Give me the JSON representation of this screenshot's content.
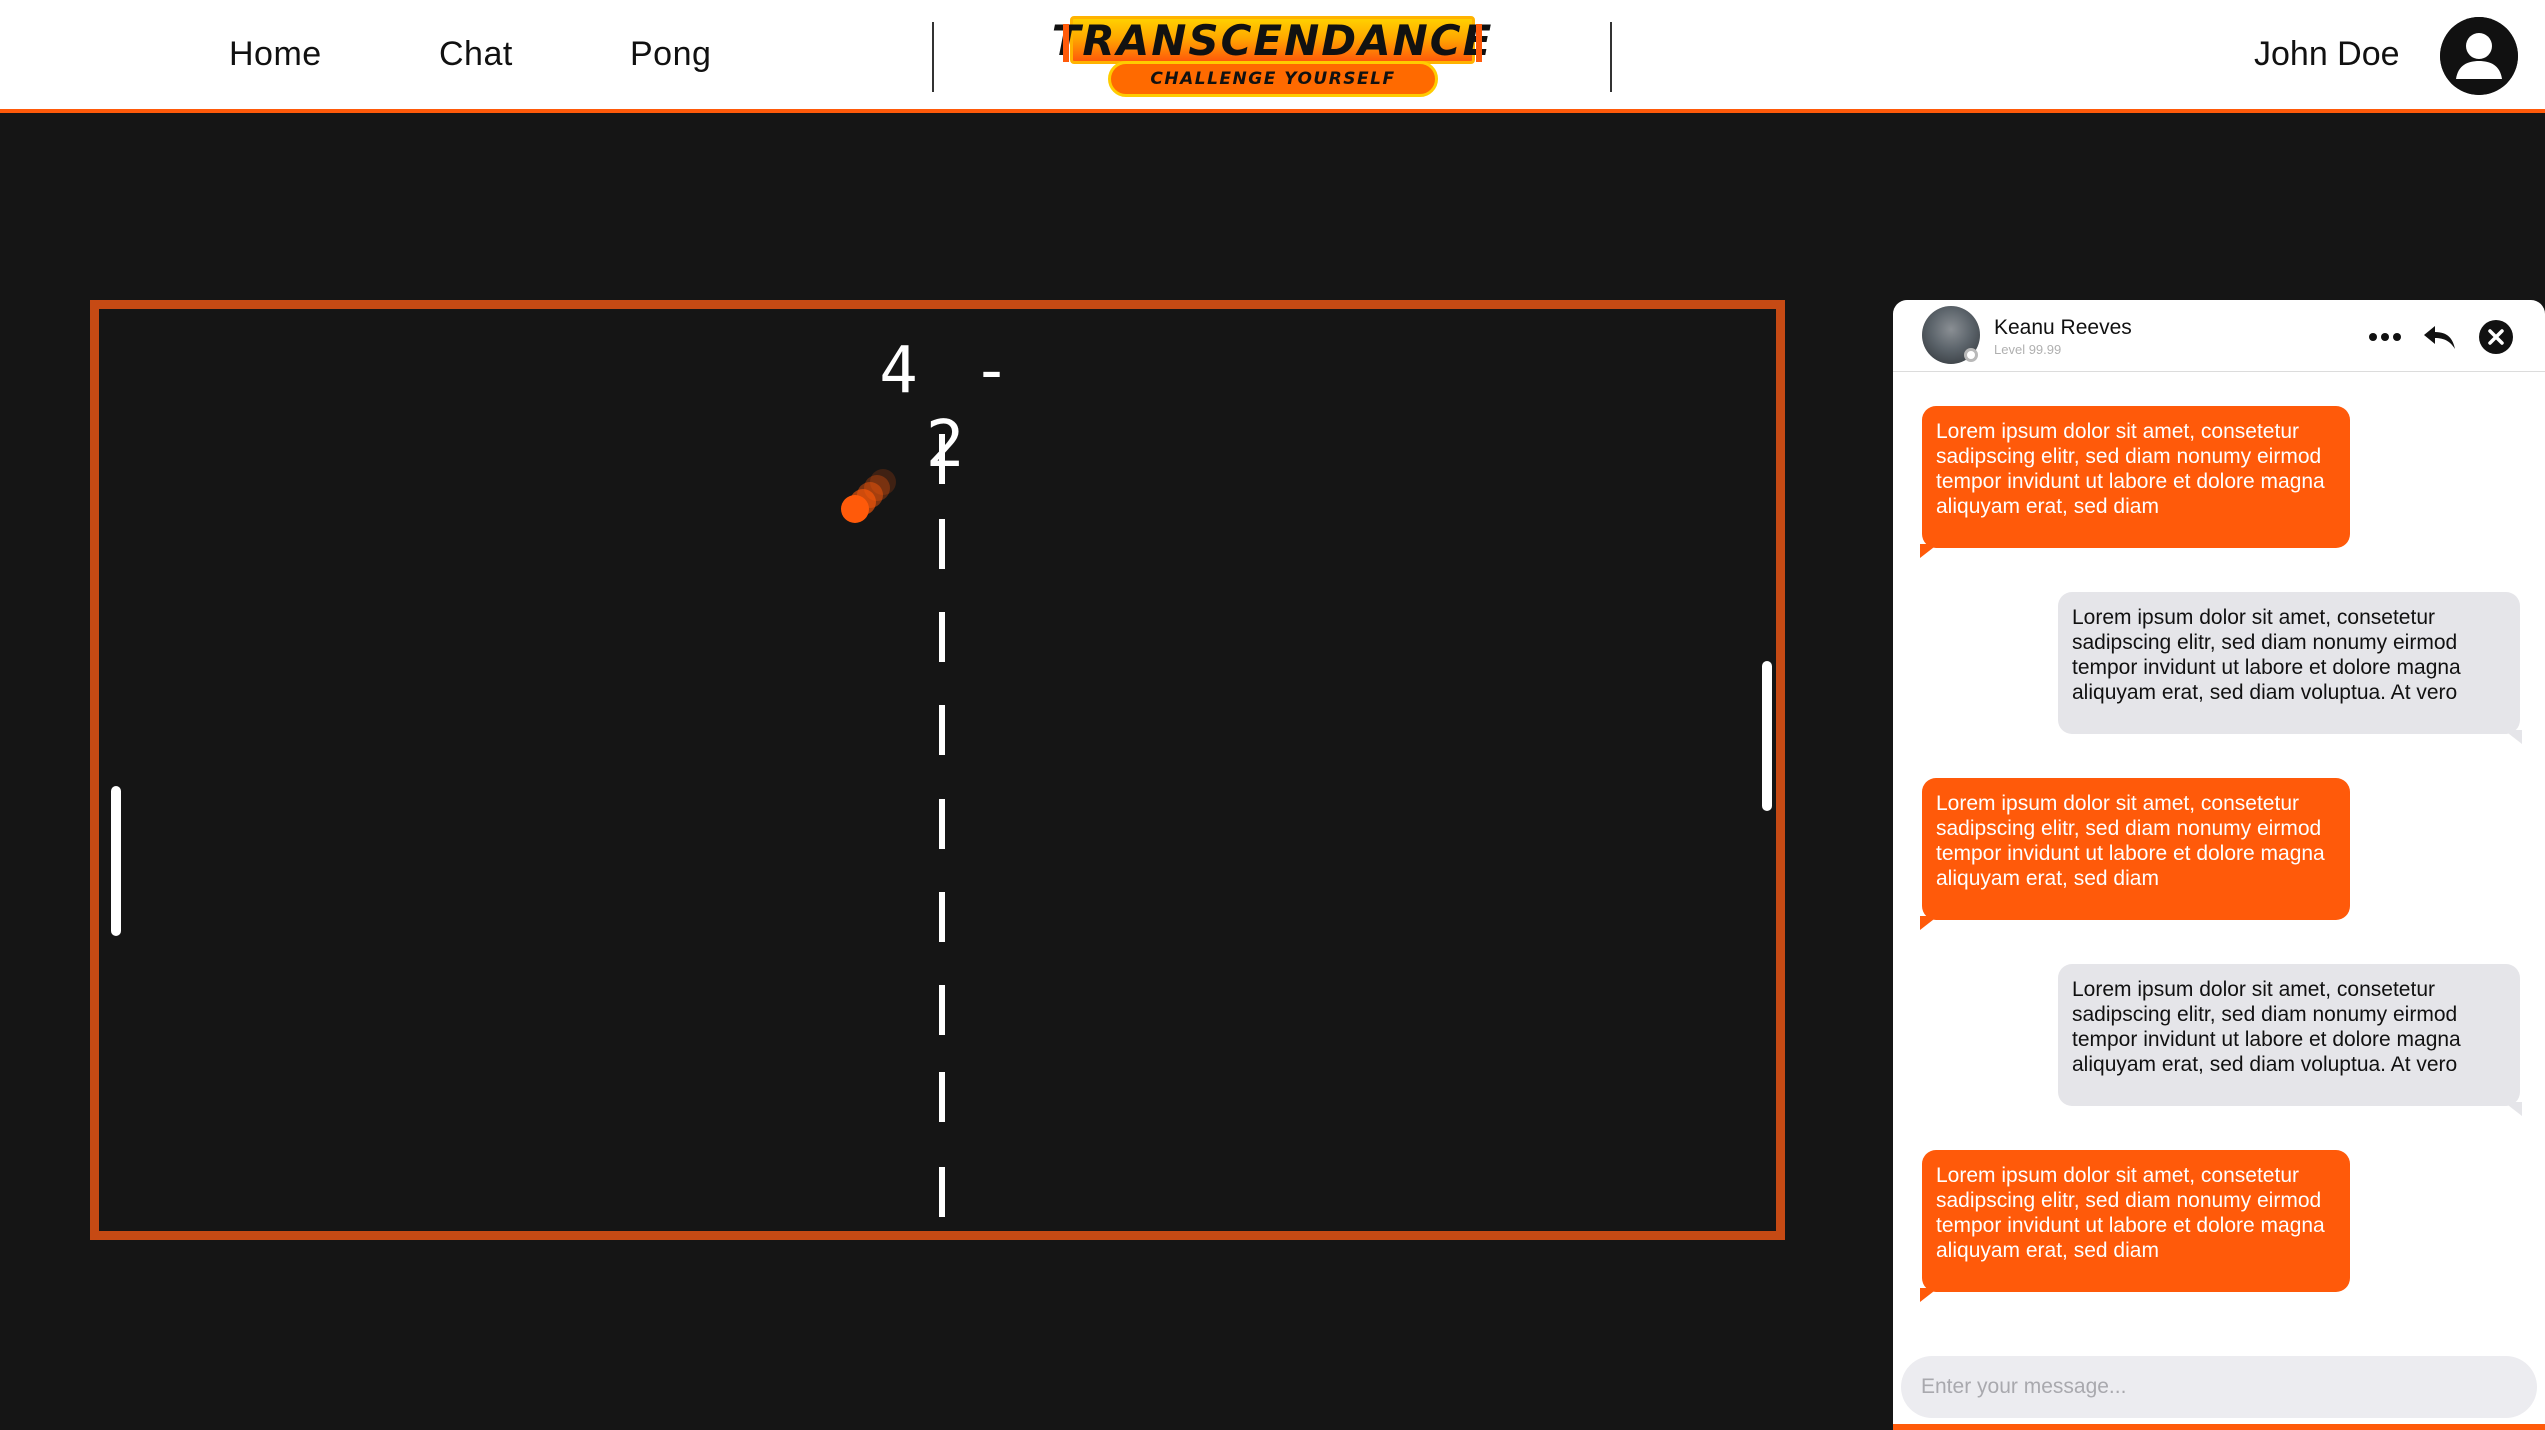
{
  "nav": {
    "home": "Home",
    "chat": "Chat",
    "pong": "Pong"
  },
  "logo": {
    "title": "TRANSCENDANCE",
    "subtitle": "CHALLENGE YOURSELF"
  },
  "user": {
    "name": "John Doe",
    "avatar_icon": "user-circle-icon"
  },
  "game": {
    "score_left": "4",
    "score_separator": "-",
    "score_right": "2",
    "colors": {
      "border": "#c64a14",
      "ball": "#ff5a0a",
      "background": "#151515"
    }
  },
  "chat": {
    "contact_name": "Keanu Reeves",
    "contact_level": "Level 99.99",
    "icons": [
      "more-icon",
      "reply-icon",
      "close-icon"
    ],
    "messages": [
      {
        "direction": "out",
        "text": "Lorem ipsum dolor sit amet, consetetur sadipscing elitr, sed diam nonumy eirmod tempor invidunt ut labore et dolore magna aliquyam erat, sed diam"
      },
      {
        "direction": "in",
        "text": "Lorem ipsum dolor sit amet, consetetur sadipscing elitr, sed diam nonumy eirmod tempor invidunt ut labore et dolore magna aliquyam erat, sed diam voluptua. At vero"
      },
      {
        "direction": "out",
        "text": "Lorem ipsum dolor sit amet, consetetur sadipscing elitr, sed diam nonumy eirmod tempor invidunt ut labore et dolore magna aliquyam erat, sed diam"
      },
      {
        "direction": "in",
        "text": "Lorem ipsum dolor sit amet, consetetur sadipscing elitr, sed diam nonumy eirmod tempor invidunt ut labore et dolore magna aliquyam erat, sed diam voluptua. At vero"
      },
      {
        "direction": "out",
        "text": "Lorem ipsum dolor sit amet, consetetur sadipscing elitr, sed diam nonumy eirmod tempor invidunt ut labore et dolore magna aliquyam erat, sed diam"
      }
    ],
    "input_placeholder": "Enter your message...",
    "colors": {
      "outgoing": "#ff5a0a",
      "incoming": "#e5e5e9"
    }
  }
}
